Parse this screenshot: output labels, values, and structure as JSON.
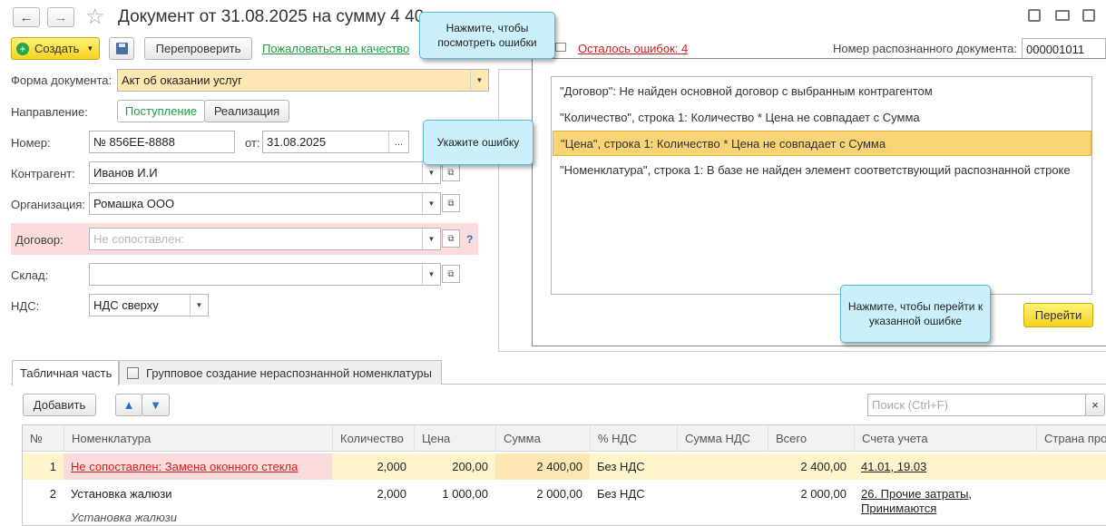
{
  "window": {
    "title": "Документ от 31.08.2025 на сумму 4 40",
    "back_icon": "←",
    "forward_icon": "→",
    "star_icon": "☆"
  },
  "toolbar": {
    "create_label": "Создать",
    "recheck_label": "Перепроверить",
    "complain_label": "Пожаловаться на качество",
    "errors_left_label": "Осталось ошибок: 4",
    "recognized_doc_label": "Номер распознанного документа:",
    "recognized_doc_value": "000001011"
  },
  "form": {
    "doc_form_label": "Форма документа:",
    "doc_form_value": "Акт об оказании услуг",
    "direction_label": "Направление:",
    "direction_in": "Поступление",
    "direction_out": "Реализация",
    "number_label": "Номер:",
    "number_value": "№ 856EE-8888",
    "date_label": "от:",
    "date_value": "31.08.2025",
    "counterparty_label": "Контрагент:",
    "counterparty_value": "Иванов И.И",
    "organization_label": "Организация:",
    "organization_value": "Ромашка ООО",
    "contract_label": "Договор:",
    "contract_placeholder": "Не сопоставлен:",
    "contract_help": "?",
    "warehouse_label": "Склад:",
    "warehouse_value": "",
    "vat_label": "НДС:",
    "vat_value": "НДС сверху"
  },
  "errors_panel": {
    "items": [
      "\"Договор\": Не найден основной договор с выбранным контрагентом",
      "\"Количество\", строка 1: Количество * Цена не совпадает с Сумма",
      "\"Цена\", строка 1: Количество * Цена не совпадает с Сумма",
      "\"Номенклатура\", строка 1: В базе не найден элемент соответствующий распознанной строке"
    ],
    "goto_label": "Перейти"
  },
  "tooltips": {
    "view_errors": "Нажмите, чтобы посмотреть ошибки",
    "select_error": "Укажите ошибку",
    "goto_error": "Нажмите, чтобы перейти к указанной ошибке"
  },
  "tabs": {
    "table_part": "Табличная часть",
    "group_create": "Групповое создание нераспознанной номенклатуры"
  },
  "table_toolbar": {
    "add_label": "Добавить",
    "search_placeholder": "Поиск (Ctrl+F)",
    "clear_icon": "×"
  },
  "table": {
    "columns": [
      "№",
      "Номенклатура",
      "Количество",
      "Цена",
      "Сумма",
      "% НДС",
      "Сумма НДС",
      "Всего",
      "Счета учета",
      "Страна про"
    ],
    "rows": [
      {
        "n": "1",
        "item": "Не сопоставлен: Замена оконного стекла",
        "qty": "2,000",
        "price": "200,00",
        "sum": "2 400,00",
        "vat": "Без НДС",
        "vat_sum": "",
        "total": "2 400,00",
        "accounts": "41.01, 19.03",
        "accounts2": ""
      },
      {
        "n": "2",
        "item": "Установка жалюзи",
        "qty": "2,000",
        "price": "1 000,00",
        "sum": "2 000,00",
        "vat": "Без НДС",
        "vat_sum": "",
        "total": "2 000,00",
        "accounts": "26. Прочие затраты,",
        "accounts2": "Принимаются"
      }
    ],
    "row2_sub": "Установка жалюзи"
  },
  "colors": {
    "accent_yellow": "#f3d320",
    "error_red": "#d02020",
    "tooltip_bg": "#ccf0fb",
    "highlight_row": "#fff5cc"
  }
}
